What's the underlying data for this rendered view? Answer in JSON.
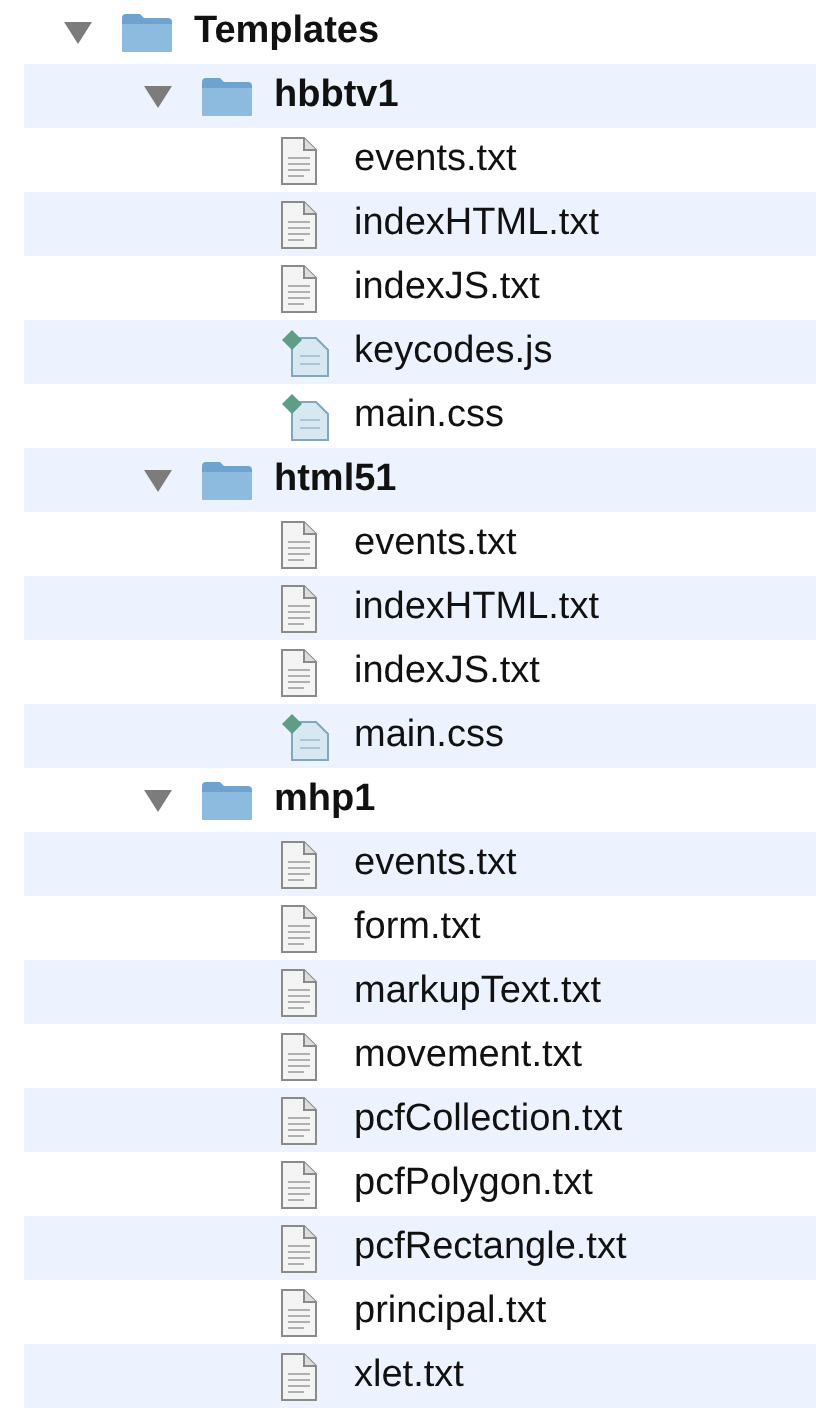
{
  "tree": [
    {
      "name": "Templates",
      "kind": "folder",
      "expanded": true,
      "children": [
        {
          "name": "hbbtv1",
          "kind": "folder",
          "expanded": true,
          "children": [
            {
              "name": "events.txt",
              "kind": "text"
            },
            {
              "name": "indexHTML.txt",
              "kind": "text"
            },
            {
              "name": "indexJS.txt",
              "kind": "text"
            },
            {
              "name": "keycodes.js",
              "kind": "script"
            },
            {
              "name": "main.css",
              "kind": "script"
            }
          ]
        },
        {
          "name": "html51",
          "kind": "folder",
          "expanded": true,
          "children": [
            {
              "name": "events.txt",
              "kind": "text"
            },
            {
              "name": "indexHTML.txt",
              "kind": "text"
            },
            {
              "name": "indexJS.txt",
              "kind": "text"
            },
            {
              "name": "main.css",
              "kind": "script"
            }
          ]
        },
        {
          "name": "mhp1",
          "kind": "folder",
          "expanded": true,
          "children": [
            {
              "name": "events.txt",
              "kind": "text"
            },
            {
              "name": "form.txt",
              "kind": "text"
            },
            {
              "name": "markupText.txt",
              "kind": "text"
            },
            {
              "name": "movement.txt",
              "kind": "text"
            },
            {
              "name": "pcfCollection.txt",
              "kind": "text"
            },
            {
              "name": "pcfPolygon.txt",
              "kind": "text"
            },
            {
              "name": "pcfRectangle.txt",
              "kind": "text"
            },
            {
              "name": "principal.txt",
              "kind": "text"
            },
            {
              "name": "xlet.txt",
              "kind": "text"
            }
          ]
        }
      ]
    }
  ]
}
